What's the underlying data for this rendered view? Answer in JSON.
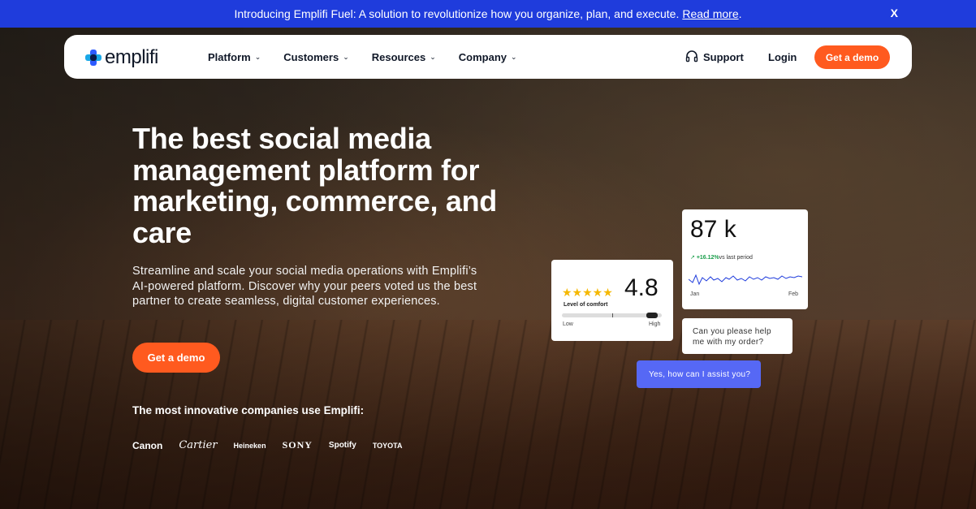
{
  "announcement": {
    "text": "Introducing Emplifi Fuel: A solution to revolutionize how you organize, plan, and execute.",
    "link": "Read more",
    "period": ".",
    "close": "X"
  },
  "nav": {
    "logo": "emplifi",
    "items": [
      {
        "label": "Platform"
      },
      {
        "label": "Customers"
      },
      {
        "label": "Resources"
      },
      {
        "label": "Company"
      }
    ],
    "support": "Support",
    "login": "Login",
    "demo": "Get a demo"
  },
  "hero": {
    "headline": "The best social media management platform for marketing, commerce, and care",
    "subtext": "Streamline and scale your social media operations with Emplifi’s AI-powered platform. Discover why your peers voted us the best partner to create seamless, digital customer experiences.",
    "cta": "Get a demo",
    "trust": "The most innovative companies use Emplifi:",
    "brands": [
      "Canon",
      "Cartier",
      "Heineken",
      "SONY",
      "Spotify",
      "TOYOTA"
    ]
  },
  "rating_card": {
    "stars": "★★★★★",
    "value": "4.8",
    "label": "Level of comfort",
    "low": "Low",
    "high": "High",
    "level": 0.9
  },
  "stat_card": {
    "value": "87 k",
    "change": "+16.12%",
    "change_suffix": "vs last period",
    "start": "Jan",
    "end": "Feb"
  },
  "chat": {
    "question": "Can you please help me with my order?",
    "answer": "Yes, how can I assist you?"
  },
  "colors": {
    "accent": "#ff5a1f",
    "announce_bg": "#1f3cdc",
    "chat_bubble": "#5668f5"
  }
}
